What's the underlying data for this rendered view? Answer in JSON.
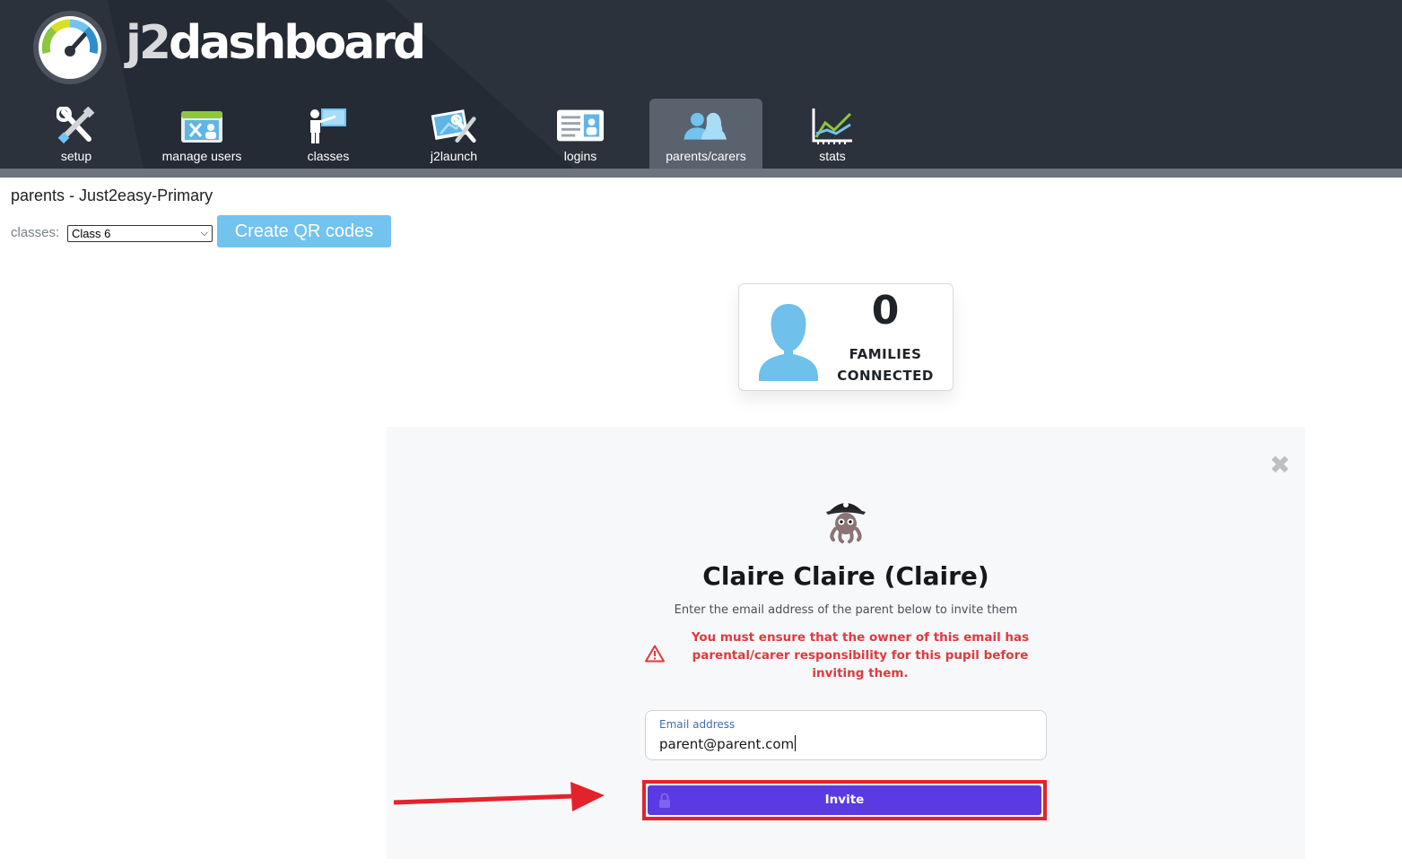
{
  "app": {
    "brand_prefix": "j2",
    "brand_suffix": "dashboard"
  },
  "nav": {
    "items": [
      {
        "label": "setup",
        "icon": "tools-icon"
      },
      {
        "label": "manage users",
        "icon": "manage-users-icon"
      },
      {
        "label": "classes",
        "icon": "teacher-board-icon"
      },
      {
        "label": "j2launch",
        "icon": "launch-tools-icon"
      },
      {
        "label": "logins",
        "icon": "id-card-icon"
      },
      {
        "label": "parents/carers",
        "icon": "parents-icon",
        "active": true
      },
      {
        "label": "stats",
        "icon": "line-chart-icon"
      }
    ]
  },
  "page": {
    "heading": "parents - Just2easy-Primary",
    "classes_label": "classes:",
    "classes_selected": "Class 6",
    "qr_button": "Create QR codes"
  },
  "families": {
    "count": "0",
    "label_line1": "FAMILIES",
    "label_line2": "CONNECTED"
  },
  "invite": {
    "pupil_name": "Claire Claire (Claire)",
    "instruction": "Enter the email address of the parent below to invite them",
    "warning": "You must ensure that the owner of this email has parental/carer responsibility for this pupil before inviting them.",
    "email_label": "Email address",
    "email_value": "parent@parent.com",
    "invite_button": "Invite"
  },
  "colors": {
    "header_bg": "#2b323c",
    "accent_blue": "#72c3ee",
    "invite_purple": "#5b3ae3",
    "warning_red": "#e0393e",
    "annotation_red": "#e3232b"
  }
}
